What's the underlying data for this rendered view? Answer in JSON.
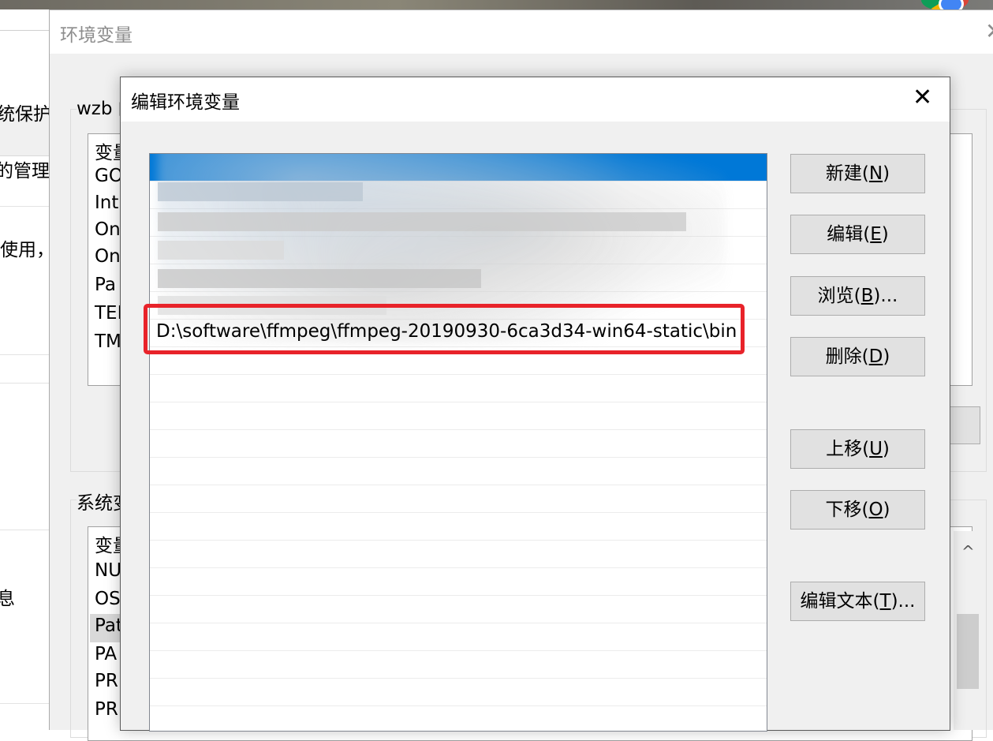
{
  "system_properties": {
    "fragments": [
      "统保护",
      "的管理员",
      "使用，",
      "息"
    ]
  },
  "env_window": {
    "title": "环境变量",
    "close_glyph": "✕",
    "user_section_label": "wzb 的",
    "user_list_header": "变量",
    "user_vars": [
      "GO",
      "Int",
      "On",
      "On",
      "Pa",
      "TEI",
      "TM"
    ],
    "system_section_label": "系统变",
    "system_list_header": "变量",
    "system_vars": [
      "NU",
      "OS",
      "Pat",
      "PA",
      "PR",
      "PR"
    ],
    "scroll_up_glyph": "^"
  },
  "edit_dialog": {
    "title": "编辑环境变量",
    "close_glyph": "✕",
    "visible_path_entry": "D:\\software\\ffmpeg\\ffmpeg-20190930-6ca3d34-win64-static\\bin",
    "buttons": {
      "new": {
        "text": "新建(",
        "key": "N",
        "end": ")"
      },
      "edit": {
        "text": "编辑(",
        "key": "E",
        "end": ")"
      },
      "browse": {
        "text": "浏览(",
        "key": "B",
        "end": ")..."
      },
      "delete": {
        "text": "删除(",
        "key": "D",
        "end": ")"
      },
      "move_up": {
        "text": "上移(",
        "key": "U",
        "end": ")"
      },
      "move_down": {
        "text": "下移(",
        "key": "O",
        "end": ")"
      },
      "edit_text": {
        "text": "编辑文本(",
        "key": "T",
        "end": ")..."
      }
    },
    "highlight_color": "#e8232a",
    "selection_color": "#0078d7"
  }
}
